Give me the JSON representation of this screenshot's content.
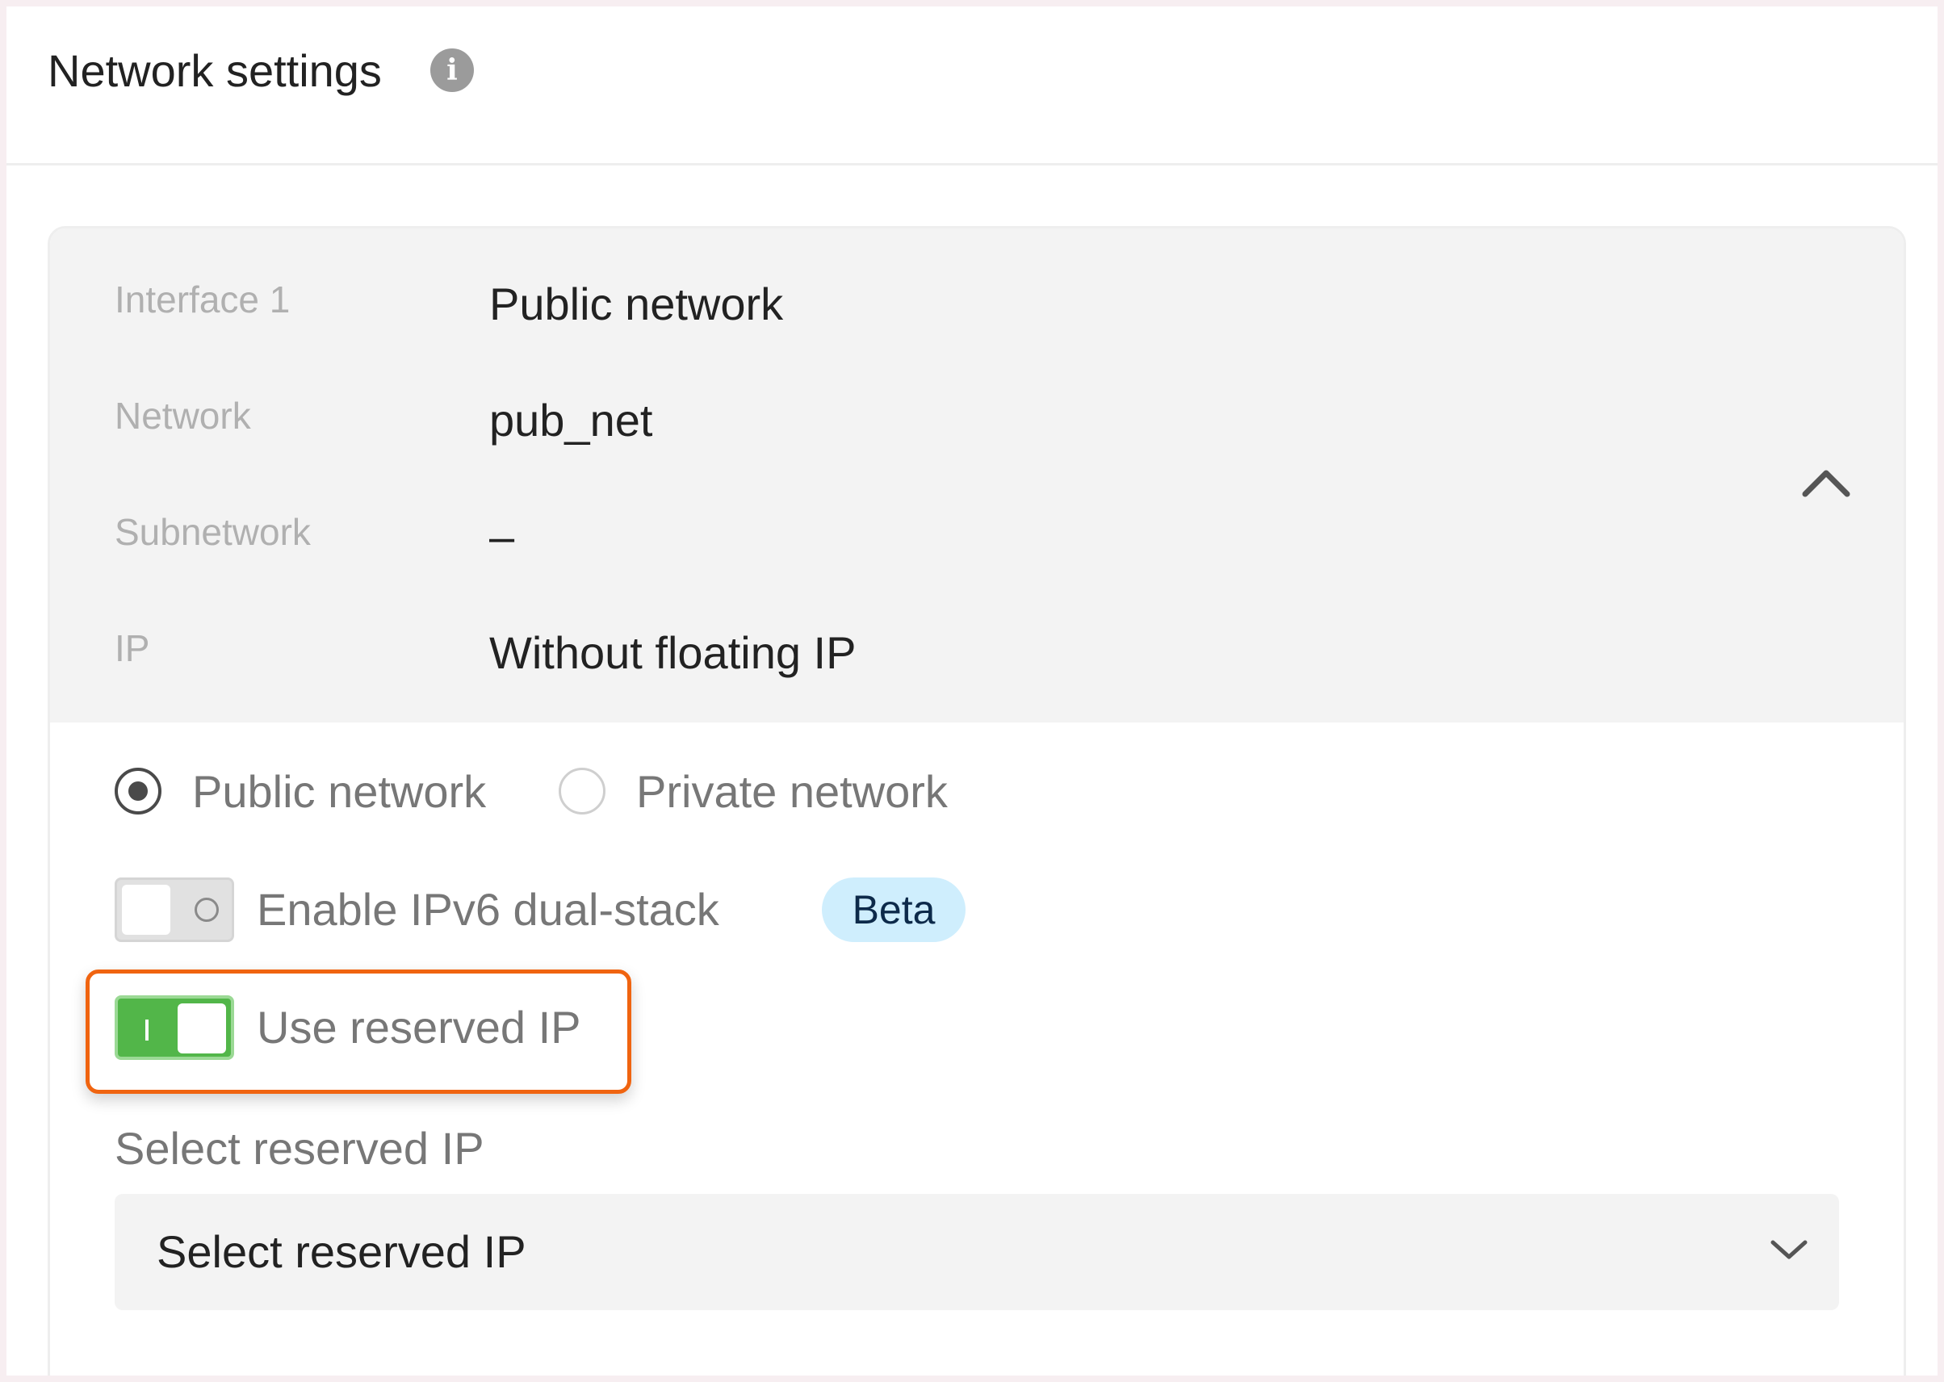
{
  "header": {
    "title": "Network settings",
    "info_icon": "info-icon"
  },
  "interface": {
    "rows": [
      {
        "label": "Interface 1",
        "value": "Public network"
      },
      {
        "label": "Network",
        "value": "pub_net"
      },
      {
        "label": "Subnetwork",
        "value": "–"
      },
      {
        "label": "IP",
        "value": "Without floating IP"
      }
    ],
    "collapse_icon": "chevron-up-icon"
  },
  "network_type": {
    "options": [
      {
        "label": "Public network",
        "selected": true
      },
      {
        "label": "Private network",
        "selected": false
      }
    ]
  },
  "ipv6": {
    "label": "Enable IPv6 dual-stack",
    "enabled": false,
    "badge": "Beta"
  },
  "reserved_ip": {
    "label": "Use reserved IP",
    "enabled": true,
    "field_label": "Select reserved IP",
    "select_value": "Select reserved IP",
    "select_icon": "chevron-down-icon"
  },
  "colors": {
    "toggle_on": "#52b649",
    "highlight": "#f06410",
    "beta_bg": "#cfeefd"
  }
}
